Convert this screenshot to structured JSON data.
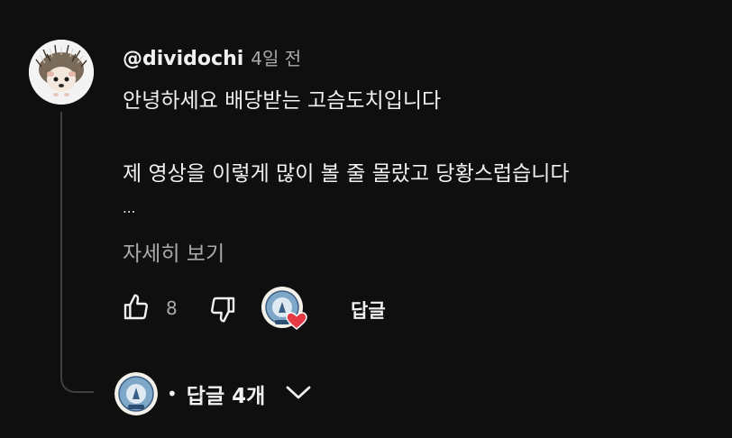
{
  "comment": {
    "author": "@dividochi",
    "time": "4일 전",
    "text_lines": [
      "안녕하세요 배당받는 고슴도치입니다",
      "제 영상을 이렇게 많이 볼 줄 몰랐고 당황스럽습니다"
    ],
    "truncation": "...",
    "read_more": "자세히 보기",
    "like_count": "8",
    "reply_label": "답글",
    "replies_label": "답글 4개"
  },
  "colors": {
    "background": "#0f0f0f",
    "primary_text": "#f1f1f1",
    "secondary_text": "#aaaaaa",
    "heart": "#e53945",
    "thread_line": "#3f3f3f"
  },
  "icons": {
    "like": "thumbs-up-icon",
    "dislike": "thumbs-down-icon",
    "creator_heart": "creator-heart-icon",
    "expand": "chevron-down-icon"
  }
}
